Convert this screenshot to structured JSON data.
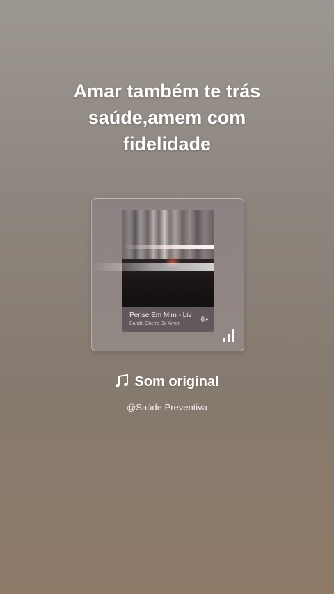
{
  "caption": {
    "line1": "Amar também te trás",
    "line2": "saúde,amem com",
    "line3": "fidelidade"
  },
  "music_card": {
    "track_title": "Pense Em Mim - Liv",
    "track_artist": "Banda Cheiro De Amor",
    "icons": [
      "audio-wave-icon",
      "signal-bars-icon"
    ]
  },
  "sound": {
    "label": "Som original",
    "icon": "music-note-icon",
    "author": "@Saúde Preventiva"
  }
}
